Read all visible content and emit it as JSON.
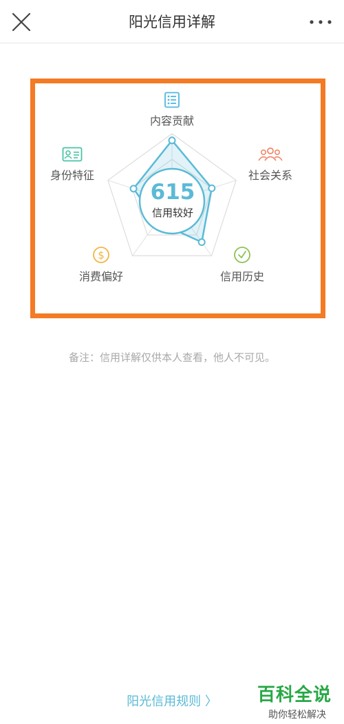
{
  "header": {
    "title": "阳光信用详解"
  },
  "credit": {
    "score": "615",
    "level": "信用较好",
    "dimensions": [
      {
        "label": "内容贡献",
        "icon": "list-icon",
        "color": "#4fb7e3",
        "value": 0.9
      },
      {
        "label": "社会关系",
        "icon": "group-icon",
        "color": "#f0886a",
        "value": 0.62
      },
      {
        "label": "信用历史",
        "icon": "clock-icon",
        "color": "#8cc152",
        "value": 0.75
      },
      {
        "label": "消费偏好",
        "icon": "dollar-icon",
        "color": "#f2b441",
        "value": 0.38
      },
      {
        "label": "身份特征",
        "icon": "id-card-icon",
        "color": "#48c4a5",
        "value": 0.6
      }
    ]
  },
  "note": "备注：信用详解仅供本人查看，他人不可见。",
  "rules_link": "阳光信用规则 〉",
  "watermark": {
    "main": "百科全说",
    "sub": "助你轻松解决"
  },
  "colors": {
    "accent": "#5bbad6",
    "highlight": "#f47a24",
    "watermark": "#27a845"
  }
}
